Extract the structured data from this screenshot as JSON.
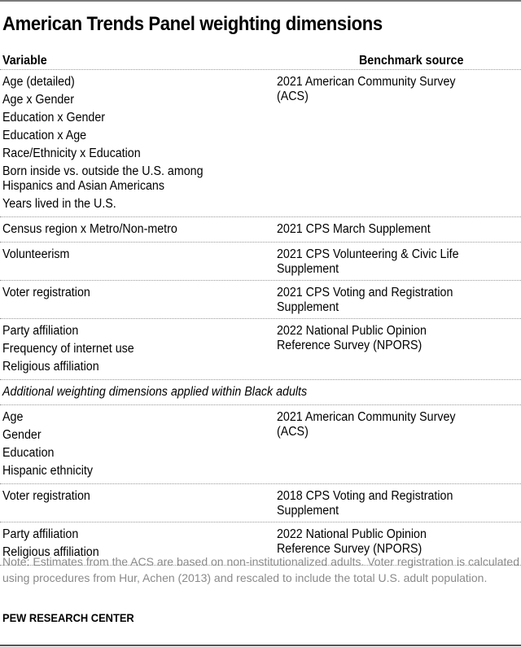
{
  "title": "American Trends Panel weighting dimensions",
  "table": {
    "headers": {
      "variable": "Variable",
      "benchmark": "Benchmark source"
    },
    "groups": [
      {
        "variables": [
          "Age (detailed)",
          "Age x Gender",
          "Education x Gender",
          "Education x Age",
          "Race/Ethnicity x Education",
          "Born inside vs. outside the U.S. among",
          "Years lived in the U.S."
        ],
        "variable_wrap": {
          "index": 5,
          "line2": "Hispanics and Asian Americans"
        },
        "benchmark": [
          "2021 American Community Survey",
          "(ACS)"
        ]
      },
      {
        "variables": [
          "Census region x Metro/Non-metro"
        ],
        "benchmark": [
          "2021 CPS March Supplement"
        ]
      },
      {
        "variables": [
          "Volunteerism"
        ],
        "benchmark": [
          "2021 CPS Volunteering & Civic Life",
          "Supplement"
        ]
      },
      {
        "variables": [
          "Voter registration"
        ],
        "benchmark": [
          "2021 CPS Voting and Registration",
          "Supplement"
        ]
      },
      {
        "variables": [
          "Party affiliation",
          "Frequency of internet use",
          "Religious affiliation"
        ],
        "benchmark": [
          "2022 National Public Opinion",
          "Reference Survey (NPORS)"
        ]
      }
    ],
    "subsection_label": "Additional weighting dimensions applied within Black adults",
    "black_groups": [
      {
        "variables": [
          "Age",
          "Gender",
          "Education",
          "Hispanic ethnicity"
        ],
        "benchmark": [
          "2021 American Community Survey",
          "(ACS)"
        ]
      },
      {
        "variables": [
          "Voter registration"
        ],
        "benchmark": [
          "2018 CPS Voting and Registration",
          "Supplement"
        ]
      },
      {
        "variables": [
          "Party affiliation",
          "Religious affiliation"
        ],
        "benchmark": [
          "2022 National Public Opinion",
          "Reference Survey (NPORS)"
        ]
      }
    ]
  },
  "note": "Note: Estimates from the ACS are based on non-institutionalized adults. Voter registration is calculated using procedures from Hur, Achen (2013) and rescaled to include the total U.S. adult population.",
  "source": "PEW RESEARCH CENTER"
}
